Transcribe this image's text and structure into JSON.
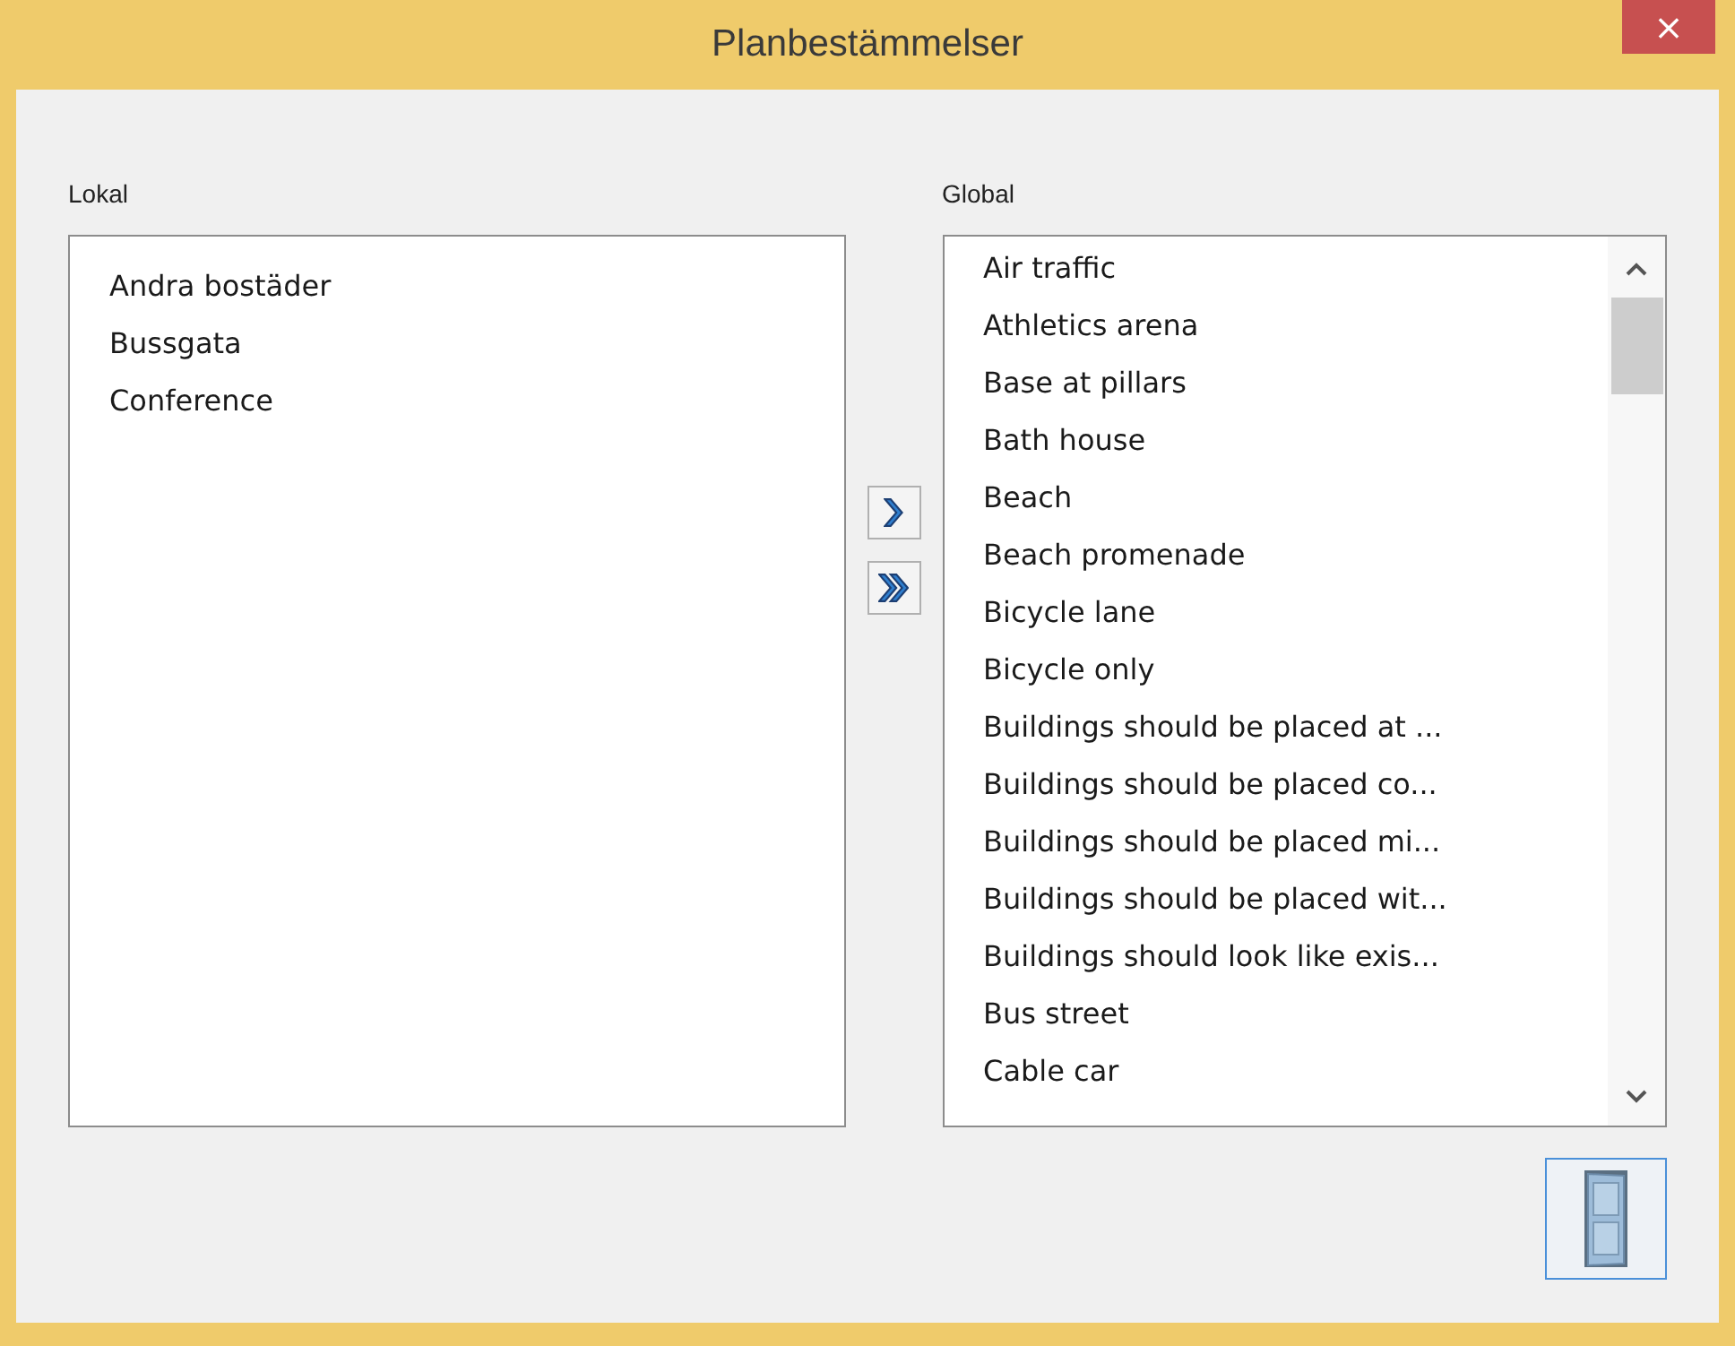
{
  "window": {
    "title": "Planbestämmelser",
    "close": "×"
  },
  "local": {
    "label": "Lokal",
    "items": [
      "Andra bostäder",
      "Bussgata",
      "Conference"
    ]
  },
  "global": {
    "label": "Global",
    "items": [
      "Air traffic",
      "Athletics arena",
      "Base at pillars",
      "Bath house",
      "Beach",
      "Beach promenade",
      "Bicycle lane",
      "Bicycle only",
      "Buildings should be placed at ...",
      "Buildings should be placed co...",
      "Buildings should be placed mi...",
      "Buildings should be placed wit...",
      "Buildings should look like exis...",
      "Bus street",
      "Cable car"
    ]
  }
}
